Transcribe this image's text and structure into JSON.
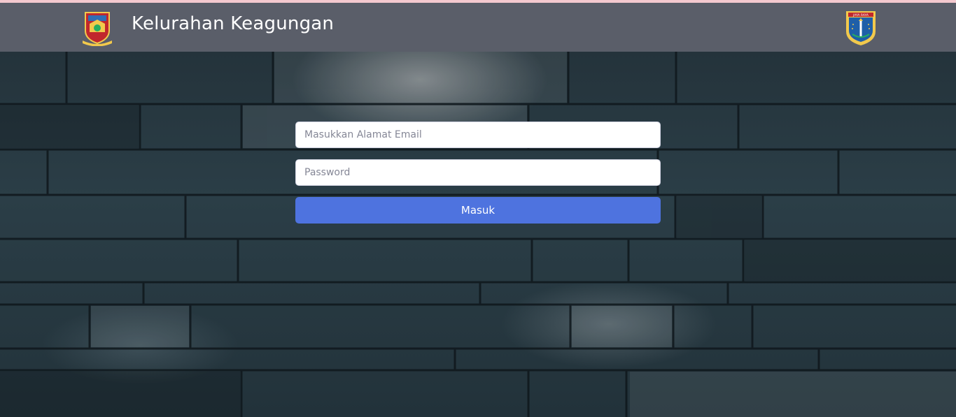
{
  "header": {
    "title": "Kelurahan Keagungan",
    "left_logo": "district-emblem",
    "right_logo": "jaya-raya-emblem",
    "right_logo_text": "JAYA RAYA",
    "background_color": "#5a5e69"
  },
  "login": {
    "email_placeholder": "Masukkan Alamat Email",
    "password_placeholder": "Password",
    "submit_label": "Masuk",
    "button_color": "#4e73df"
  },
  "background": {
    "type": "dark-stone-wall-texture"
  }
}
